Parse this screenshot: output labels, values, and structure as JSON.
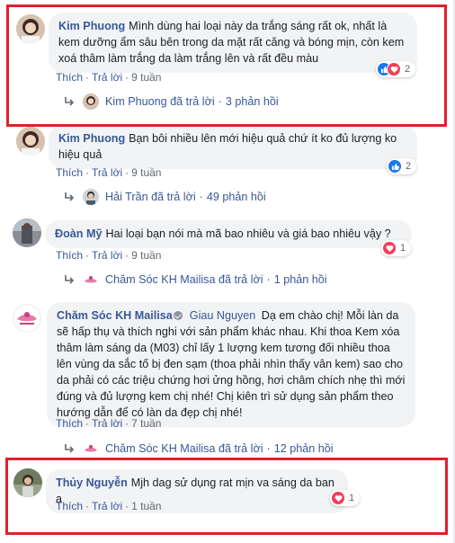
{
  "comments": [
    {
      "author": "Kim Phuong",
      "text": "Mình dùng hai loại này da trắng sáng rất ok, nhất là kem dưỡng ẩm sâu bên trong da mặt rất căng và bóng mịn, còn kem xoá thâm làm trắng da làm trắng lên và rất đều màu",
      "like_label": "Thích",
      "reply_label": "Trả lời",
      "time": "9 tuần",
      "reaction_count": "2",
      "reactions": [
        "like-icon",
        "love-icon"
      ],
      "replies": {
        "author": "Kim Phuong",
        "replied_text": "đã trả lời",
        "count": "3 phản hồi"
      }
    },
    {
      "author": "Kim Phuong",
      "text": "Bạn bôi nhiều lên mới hiệu quả chứ ít ko đủ lượng ko hiệu quả",
      "like_label": "Thích",
      "reply_label": "Trả lời",
      "time": "9 tuần",
      "reaction_count": "2",
      "reactions": [
        "like-icon"
      ],
      "replies": {
        "author": "Hải Trần",
        "replied_text": "đã trả lời",
        "count": "49 phản hồi"
      }
    },
    {
      "author": "Đoàn Mỹ",
      "text": "Hai loại bạn nói mà mã bao nhiêu và giá bao nhiêu vậy ?",
      "like_label": "Thích",
      "reply_label": "Trả lời",
      "time": "9 tuần",
      "reaction_count": "1",
      "reactions": [
        "love-icon"
      ],
      "replies": {
        "author": "Chăm Sóc KH Mailisa",
        "replied_text": "đã trả lời",
        "count": "1 phản hồi"
      }
    },
    {
      "author": "Chăm Sóc KH Mailisa",
      "tagged": "Giau Nguyen",
      "text": "Dạ em chào chị! Mỗi làn da sẽ hấp thụ và thích nghi với sản phẩm khác nhau. Khi thoa Kem xóa thâm làm sáng da (M03) chỉ lấy 1 lượng kem tương đối nhiều thoa lên vùng da sắc tố bị đen sạm (thoa phải nhìn thấy vân kem) sao cho da phải có các triệu chứng hơi ửng hồng, hơi châm chích nhẹ thì mới đúng và đủ lượng kem chị nhé! Chị kiên trì sử dụng sản phẩm theo hướng dẫn để có làn da đẹp chị nhé!",
      "like_label": "Thích",
      "reply_label": "Trả lời",
      "time": "7 tuần",
      "replies": {
        "author": "Chăm Sóc KH Mailisa",
        "replied_text": "đã trả lời",
        "count": "12 phản hồi"
      }
    },
    {
      "author": "Thủy Nguyễn",
      "text": "Mjh dag sử dụng rat mịn va sáng da ban ạ",
      "like_label": "Thích",
      "reply_label": "Trả lời",
      "time": "1 tuần",
      "reaction_count": "1",
      "reactions": [
        "love-icon"
      ]
    }
  ],
  "colors": {
    "link": "#385898",
    "bubble": "#f2f3f5",
    "highlight": "#e0202b",
    "like": "#1877f2",
    "love": "#f33e58"
  }
}
